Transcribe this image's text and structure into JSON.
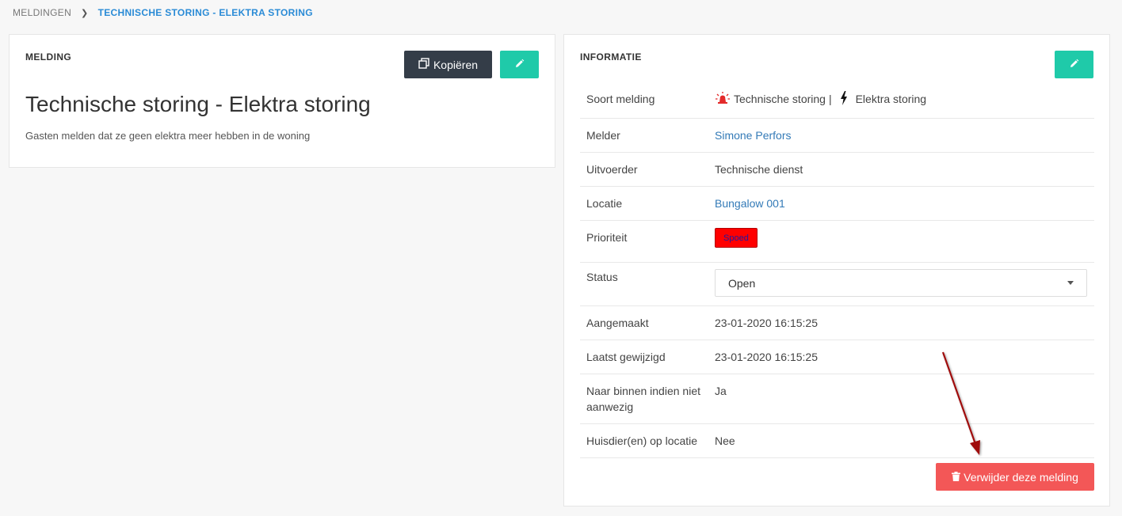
{
  "breadcrumb": {
    "root": "MELDINGEN",
    "current": "TECHNISCHE STORING - ELEKTRA STORING"
  },
  "melding_panel": {
    "title": "MELDING",
    "copy_label": "Kopiëren",
    "heading": "Technische storing - Elektra storing",
    "description": "Gasten melden dat ze geen elektra meer hebben in de woning"
  },
  "info_panel": {
    "title": "INFORMATIE",
    "soort_melding": {
      "label": "Soort melding",
      "type": "Technische storing",
      "separator": "|",
      "subtype": "Elektra storing"
    },
    "melder": {
      "label": "Melder",
      "value": "Simone Perfors"
    },
    "uitvoerder": {
      "label": "Uitvoerder",
      "value": "Technische dienst"
    },
    "locatie": {
      "label": "Locatie",
      "value": "Bungalow 001"
    },
    "prioriteit": {
      "label": "Prioriteit",
      "value": "Spoed"
    },
    "status": {
      "label": "Status",
      "value": "Open"
    },
    "aangemaakt": {
      "label": "Aangemaakt",
      "value": "23-01-2020 16:15:25"
    },
    "laatst_gewijzigd": {
      "label": "Laatst gewijzigd",
      "value": "23-01-2020 16:15:25"
    },
    "naar_binnen": {
      "label": "Naar binnen indien niet aanwezig",
      "value": "Ja"
    },
    "huisdieren": {
      "label": "Huisdier(en) op locatie",
      "value": "Nee"
    },
    "delete_label": "Verwijder deze melding"
  },
  "colors": {
    "accent_teal": "#1fcaa9",
    "dark_button": "#343d48",
    "danger": "#f35757",
    "link": "#337ab7",
    "priority_badge": "#ff0000",
    "annotation_arrow": "#a01010"
  },
  "icons": {
    "copy": "copy-icon",
    "edit": "pencil-icon",
    "alarm": "alarm-light-icon",
    "bolt": "lightning-bolt-icon",
    "trash": "trash-icon",
    "caret": "chevron-down-icon"
  }
}
